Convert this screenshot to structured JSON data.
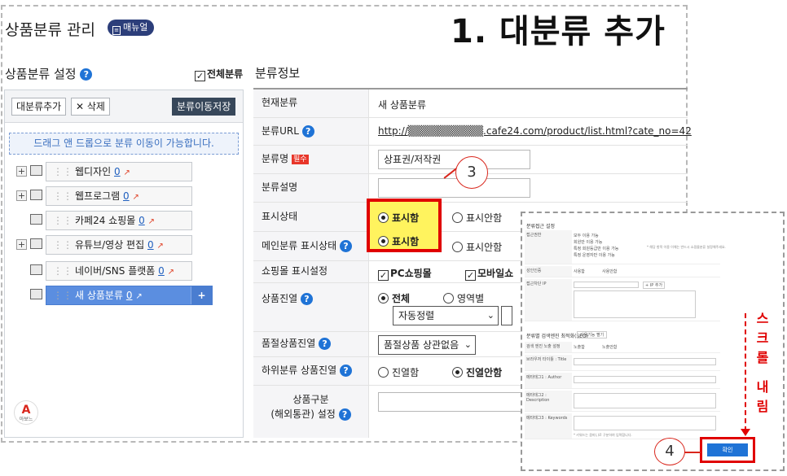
{
  "header": {
    "title": "상품분류 관리",
    "manual_label": "매뉴얼",
    "step_title": "1. 대분류 추가"
  },
  "left": {
    "section_title": "상품분류 설정",
    "all_category_label": "전체분류",
    "add_button": "대분류추가",
    "delete_button": "삭제",
    "move_save_button": "분류이동저장",
    "drag_hint": "드래그 앤 드롭으로 분류 이동이 가능합니다.",
    "categories": [
      {
        "name": "웹디자인",
        "count": "0",
        "expandable": true
      },
      {
        "name": "웹프로그램",
        "count": "0",
        "expandable": true
      },
      {
        "name": "카페24 쇼핑몰",
        "count": "0",
        "expandable": false
      },
      {
        "name": "유튜브/영상 편집",
        "count": "0",
        "expandable": true
      },
      {
        "name": "네이버/SNS 플랫폼",
        "count": "0",
        "expandable": false
      },
      {
        "name": "새 상품분류",
        "count": "0",
        "expandable": false,
        "selected": true
      }
    ],
    "logo_text": "아보느"
  },
  "info": {
    "section_title": "분류정보",
    "current_label": "현재분류",
    "current_value": "새 상품분류",
    "url_label": "분류URL",
    "url_value": "http://▒▒▒▒▒▒▒▒▒▒.cafe24.com/product/list.html?cate_no=42",
    "name_label": "분류명",
    "required_badge": "필수",
    "name_value": "상표권/저작권",
    "desc_label": "분류설명",
    "display_label": "표시상태",
    "display_on": "표시함",
    "display_off": "표시안함",
    "main_display_label": "메인분류 표시상태",
    "main_on": "표시함",
    "main_off": "표시안함",
    "mall_display_label": "쇼핑몰 표시설정",
    "mall_pc": "PC쇼핑몰",
    "mall_mobile": "모바일쇼",
    "arrange_label": "상품진열",
    "arrange_all": "전체",
    "arrange_area": "영역별",
    "arrange_select": "자동정렬",
    "soldout_label": "품절상품진열",
    "soldout_select": "품절상품 상관없음",
    "sub_label": "하위분류 상품진열",
    "sub_on": "진열함",
    "sub_off": "진열안함",
    "goods_label_1": "상품구분",
    "goods_label_2": "(해외통관) 설정"
  },
  "annotations": {
    "step3": "3",
    "step4": "4",
    "scroll_text": [
      "스",
      "크",
      "롤",
      "내",
      "림"
    ]
  },
  "overlay": {
    "header": "분류접근 설정",
    "access_label": "접근권한",
    "access_options": [
      "모두 이용 가능",
      "회원만 이용 가능",
      "특정 회원등급만 이용 가능",
      "특정 운영자만 이용 가능"
    ],
    "access_note": "* 해당 항목 이용 이해는 반드시 쇼핑몰분류 설정해주세요.",
    "adult_label": "성인인증",
    "adult_options": [
      "사용함",
      "사용안함"
    ],
    "ip_label": "접근차단 IP",
    "ip_add": "+ IP 추가",
    "seo_header": "분류별 검색엔진 최적화(SEO)",
    "seo_btn": "사용기능 펼기",
    "seo_expose_label": "검색 엔진 노출 설정",
    "seo_expose_options": [
      "노출함",
      "노출안함"
    ],
    "title_label": "브라우저 타이틀 : Title",
    "author_label": "메타태그1 : Author",
    "desc_label": "메타태그2 : Description",
    "keywords_label": "메타태그3 : Keywords",
    "keywords_note": "* 키워드는 콤마(,)로 구분하여 입력합니다.",
    "confirm": "확인"
  },
  "colors": {
    "highlight_yellow": "#fff35e",
    "highlight_red": "#e00000",
    "selected_blue": "#5b8ee0",
    "help_blue": "#1f73d6",
    "dark_button": "#37475a"
  }
}
